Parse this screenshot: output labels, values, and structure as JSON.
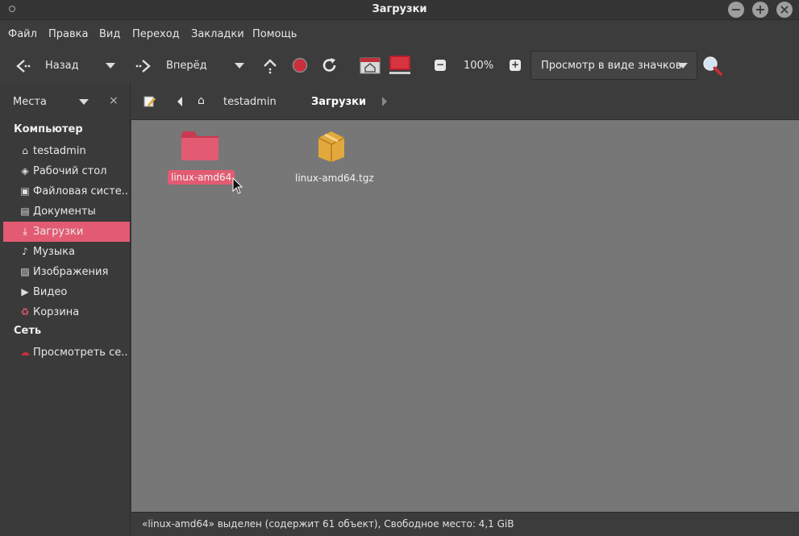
{
  "window": {
    "title": "Загрузки"
  },
  "menu": [
    "Файл",
    "Правка",
    "Вид",
    "Переход",
    "Закладки",
    "Помощь"
  ],
  "toolbar": {
    "back_label": "Назад",
    "forward_label": "Вперёд",
    "zoom": "100%",
    "view_mode": "Просмотр в виде значков"
  },
  "sidebar": {
    "title": "Места",
    "sections": [
      {
        "title": "Компьютер",
        "items": [
          {
            "label": "testadmin",
            "icon": "home-icon"
          },
          {
            "label": "Рабочий стол",
            "icon": "desktop-icon"
          },
          {
            "label": "Файловая систе...",
            "icon": "drive-icon"
          },
          {
            "label": "Документы",
            "icon": "document-icon"
          },
          {
            "label": "Загрузки",
            "icon": "download-icon",
            "active": true
          },
          {
            "label": "Музыка",
            "icon": "music-icon"
          },
          {
            "label": "Изображения",
            "icon": "image-icon"
          },
          {
            "label": "Видео",
            "icon": "video-icon"
          },
          {
            "label": "Корзина",
            "icon": "trash-icon"
          }
        ]
      },
      {
        "title": "Сеть",
        "items": [
          {
            "label": "Просмотреть се...",
            "icon": "network-icon"
          }
        ]
      }
    ]
  },
  "pathbar": {
    "crumbs": [
      "testadmin",
      "Загрузки"
    ]
  },
  "files": [
    {
      "name": "linux-amd64",
      "type": "folder",
      "selected": true,
      "color": "#e25b72"
    },
    {
      "name": "linux-amd64.tgz",
      "type": "archive",
      "selected": false,
      "color": "#e3a83c"
    }
  ],
  "status": "«linux-amd64» выделен (содержит 61 объект), Свободное место: 4,1 GiB",
  "colors": {
    "accent": "#e25b72",
    "content_bg": "#777777",
    "chrome_bg": "#3c3c3c"
  }
}
